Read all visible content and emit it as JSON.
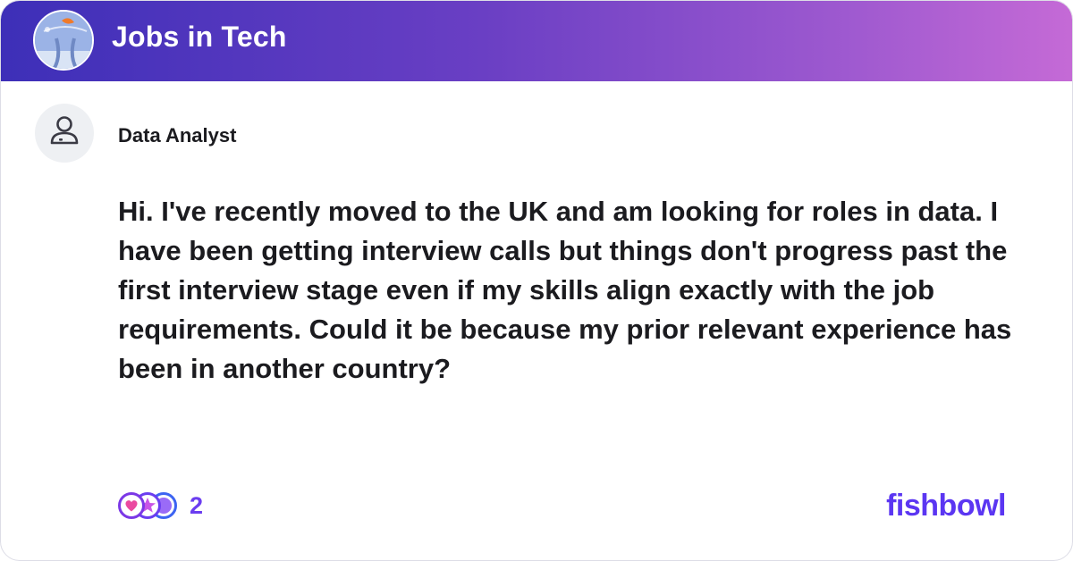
{
  "header": {
    "bowl_icon": "bowl-logo",
    "title": "Jobs in Tech"
  },
  "post": {
    "avatar_icon": "user-icon",
    "author": "Data Analyst",
    "body": "Hi. I've recently moved to the UK and am looking for roles in data. I have been getting interview calls but things don't progress past the first interview stage even if my skills align exactly with the job requirements. Could it be because my prior relevant experience has been in another country?"
  },
  "footer": {
    "reaction_icons": [
      "heart-icon",
      "star-icon",
      "smile-icon"
    ],
    "reaction_count": "2",
    "brand": "fishbowl"
  },
  "colors": {
    "header_gradient_start": "#3d2fb8",
    "header_gradient_end": "#c56ad6",
    "brand": "#5b36f2"
  }
}
